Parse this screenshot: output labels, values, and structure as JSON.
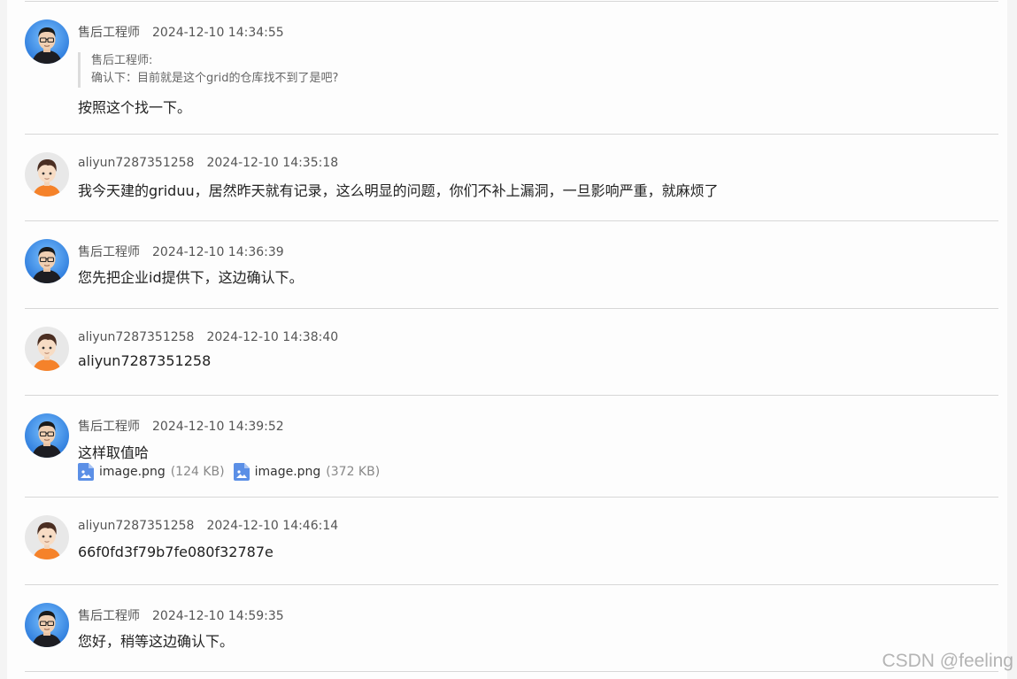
{
  "messages": [
    {
      "author": "售后工程师",
      "time": "2024-12-10 14:34:55",
      "quote_author": "售后工程师:",
      "quote_text": "确认下：目前就是这个grid的仓库找不到了是吧?",
      "text": "按照这个找一下。",
      "avatar": "engineer-avatar"
    },
    {
      "author": "aliyun7287351258",
      "time": "2024-12-10 14:35:18",
      "text": "我今天建的griduu，居然昨天就有记录，这么明显的问题，你们不补上漏洞，一旦影响严重，就麻烦了",
      "avatar": "customer-avatar"
    },
    {
      "author": "售后工程师",
      "time": "2024-12-10 14:36:39",
      "text": "您先把企业id提供下，这边确认下。",
      "avatar": "engineer-avatar"
    },
    {
      "author": "aliyun7287351258",
      "time": "2024-12-10 14:38:40",
      "text": "aliyun7287351258",
      "avatar": "customer-avatar"
    },
    {
      "author": "售后工程师",
      "time": "2024-12-10 14:39:52",
      "text": "这样取值哈",
      "avatar": "engineer-avatar",
      "attachments": [
        {
          "name": "image.png",
          "size": "(124 KB)",
          "icon": "image-file-icon"
        },
        {
          "name": "image.png",
          "size": "(372 KB)",
          "icon": "image-file-icon"
        }
      ]
    },
    {
      "author": "aliyun7287351258",
      "time": "2024-12-10 14:46:14",
      "text": "66f0fd3f79b7fe080f32787e",
      "avatar": "customer-avatar"
    },
    {
      "author": "售后工程师",
      "time": "2024-12-10 14:59:35",
      "text": "您好，稍等这边确认下。",
      "avatar": "engineer-avatar"
    }
  ],
  "watermark": "CSDN @feeling",
  "colors": {
    "engineer_avatar_bg": "#3a86e0",
    "customer_avatar_bg": "#e6e6e6",
    "customer_shirt": "#f5822a",
    "attachment_icon": "#5b8fe6"
  }
}
